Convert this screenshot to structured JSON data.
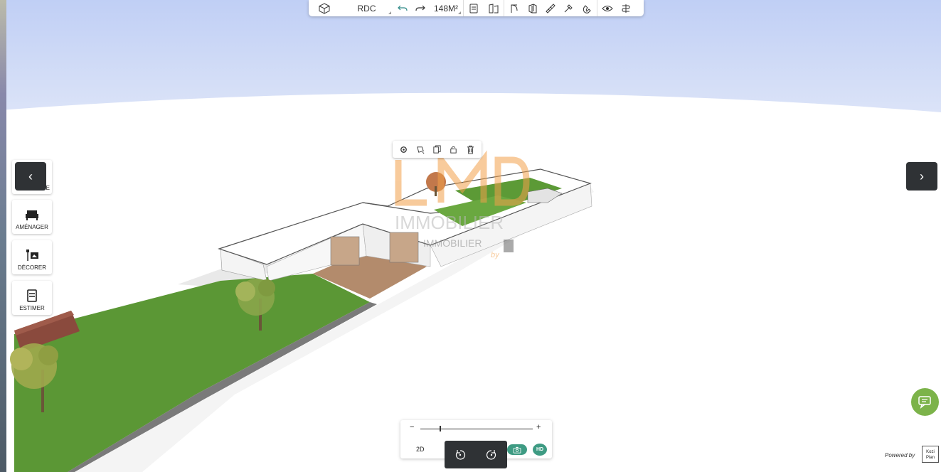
{
  "toolbar": {
    "level": "RDC",
    "area": "148M²"
  },
  "side_panel": {
    "items": [
      {
        "label": "AMÉNAGER",
        "icon": "sofa-icon"
      },
      {
        "label": "DÉCORER",
        "icon": "lamp-frame-icon"
      },
      {
        "label": "ESTIMER",
        "icon": "cart-icon"
      }
    ],
    "hidden_first_label_fragment": "E"
  },
  "bottom": {
    "zoom_minus": "−",
    "zoom_plus": "+",
    "zoom_level": 0.17,
    "view_2d": "2D",
    "hd_label": "HD"
  },
  "watermark": {
    "line1": "IMMOBILIER",
    "line2": "IMMOBILIER",
    "by": "by"
  },
  "footer": {
    "powered_by": "Powered by",
    "logo_text": "Kozi Plan"
  },
  "colors": {
    "sky": "#c4d3f5",
    "grass": "#5d9b38",
    "wall": "#ffffff",
    "accent_green": "#3e9b83",
    "chat_green": "#7cb34a",
    "dark": "#2f3235"
  }
}
